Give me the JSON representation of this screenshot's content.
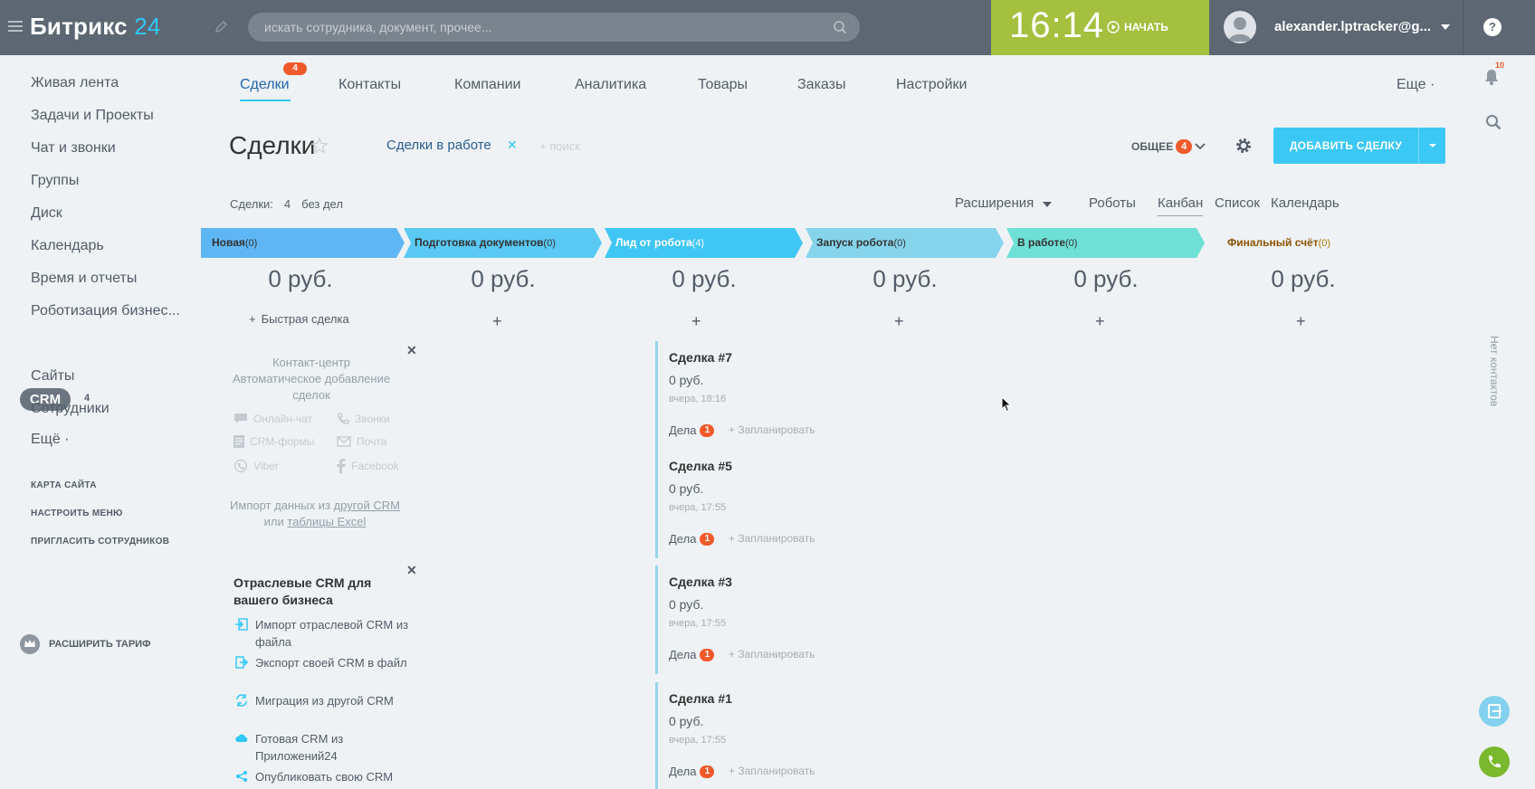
{
  "topbar": {
    "logo_main": "Битрикс",
    "logo_num": "24",
    "search_placeholder": "искать сотрудника, документ, прочее...",
    "clock_time": "16:14",
    "start_label": "НАЧАТЬ",
    "user_name": "alexander.lptracker@g...",
    "help_label": "?"
  },
  "sidebar": {
    "items": [
      {
        "label": "Живая лента"
      },
      {
        "label": "Задачи и Проекты"
      },
      {
        "label": "Чат и звонки"
      },
      {
        "label": "Группы"
      },
      {
        "label": "Диск"
      },
      {
        "label": "Календарь"
      },
      {
        "label": "Время и отчеты"
      },
      {
        "label": "Роботизация бизнес..."
      },
      {
        "label": "CRM",
        "count": "4"
      },
      {
        "label": "Сайты"
      },
      {
        "label": "Сотрудники"
      },
      {
        "label": "Ещё ·"
      }
    ],
    "links": [
      "КАРТА САЙТА",
      "НАСТРОИТЬ МЕНЮ",
      "ПРИГЛАСИТЬ СОТРУДНИКОВ"
    ],
    "tariff_label": "РАСШИРИТЬ ТАРИФ"
  },
  "tabs": [
    {
      "label": "Сделки",
      "badge": "4"
    },
    {
      "label": "Контакты"
    },
    {
      "label": "Компании"
    },
    {
      "label": "Аналитика"
    },
    {
      "label": "Товары"
    },
    {
      "label": "Заказы"
    },
    {
      "label": "Настройки"
    }
  ],
  "tabs_more": "Еще ·",
  "page": {
    "title": "Сделки",
    "filter_chip": "Сделки в работе",
    "filter_x": "✕",
    "filter_search": "+ поиск",
    "general_label": "ОБЩЕЕ",
    "general_badge": "4",
    "add_button": "ДОБАВИТЬ СДЕЛКУ"
  },
  "counter": {
    "label": "Сделки:",
    "value": "4",
    "suffix": "без дел"
  },
  "views": {
    "extensions": "Расширения",
    "robots": "Роботы",
    "kanban": "Канбан",
    "list": "Список",
    "calendar": "Календарь"
  },
  "stages": [
    {
      "name": "Новая",
      "count": "(0)",
      "sum": "0 руб.",
      "color": "#5fb6f4"
    },
    {
      "name": "Подготовка документов",
      "count": "(0)",
      "sum": "0 руб.",
      "color": "#5ac9f4"
    },
    {
      "name": "Лид от робота",
      "count": "(4)",
      "sum": "0 руб.",
      "color": "#3fc6f4"
    },
    {
      "name": "Запуск робота",
      "count": "(0)",
      "sum": "0 руб.",
      "color": "#86d4eb"
    },
    {
      "name": "В работе",
      "count": "(0)",
      "sum": "0 руб.",
      "color": "#6ee0d6"
    },
    {
      "name": "Финальный счёт",
      "count": "(0)",
      "sum": "0 руб.",
      "color": "#ffffff"
    }
  ],
  "quick_deal": "Быстрая сделка",
  "plus": "+",
  "contact_center": {
    "title_1": "Контакт-центр",
    "title_2": "Автоматическое добавление",
    "title_3": "сделок",
    "channels": [
      "Онлайн-чат",
      "Звонки",
      "CRM-формы",
      "Почта",
      "Viber",
      "Facebook"
    ],
    "import_1": "Импорт данных из",
    "import_link_1": "другой CRM",
    "import_2": "или",
    "import_link_2": "таблицы Excel"
  },
  "industry": {
    "title": "Отраслевые CRM для вашего бизнеса",
    "items": [
      "Импорт отраслевой CRM из файла",
      "Экспорт своей CRM в файл",
      "Миграция из другой CRM",
      "Готовая CRM из Приложений24",
      "Опубликовать свою CRM"
    ]
  },
  "deals": [
    {
      "title": "Сделка #7",
      "amount": "0 руб.",
      "date": "вчера, 18:16",
      "acts": "Дела",
      "badge": "1",
      "plan": "+ Запланировать"
    },
    {
      "title": "Сделка #5",
      "amount": "0 руб.",
      "date": "вчера, 17:55",
      "acts": "Дела",
      "badge": "1",
      "plan": "+ Запланировать"
    },
    {
      "title": "Сделка #3",
      "amount": "0 руб.",
      "date": "вчера, 17:55",
      "acts": "Дела",
      "badge": "1",
      "plan": "+ Запланировать"
    },
    {
      "title": "Сделка #1",
      "amount": "0 руб.",
      "date": "вчера, 17:55",
      "acts": "Дела",
      "badge": "1",
      "plan": "+ Запланировать"
    }
  ],
  "right_panel": {
    "badge": "10",
    "vertical": "Нет контактов"
  },
  "colors": {
    "topbar": "#5c6773",
    "clock": "#a4c03e",
    "accent": "#3bc8f5",
    "badge": "#f05a2b"
  }
}
